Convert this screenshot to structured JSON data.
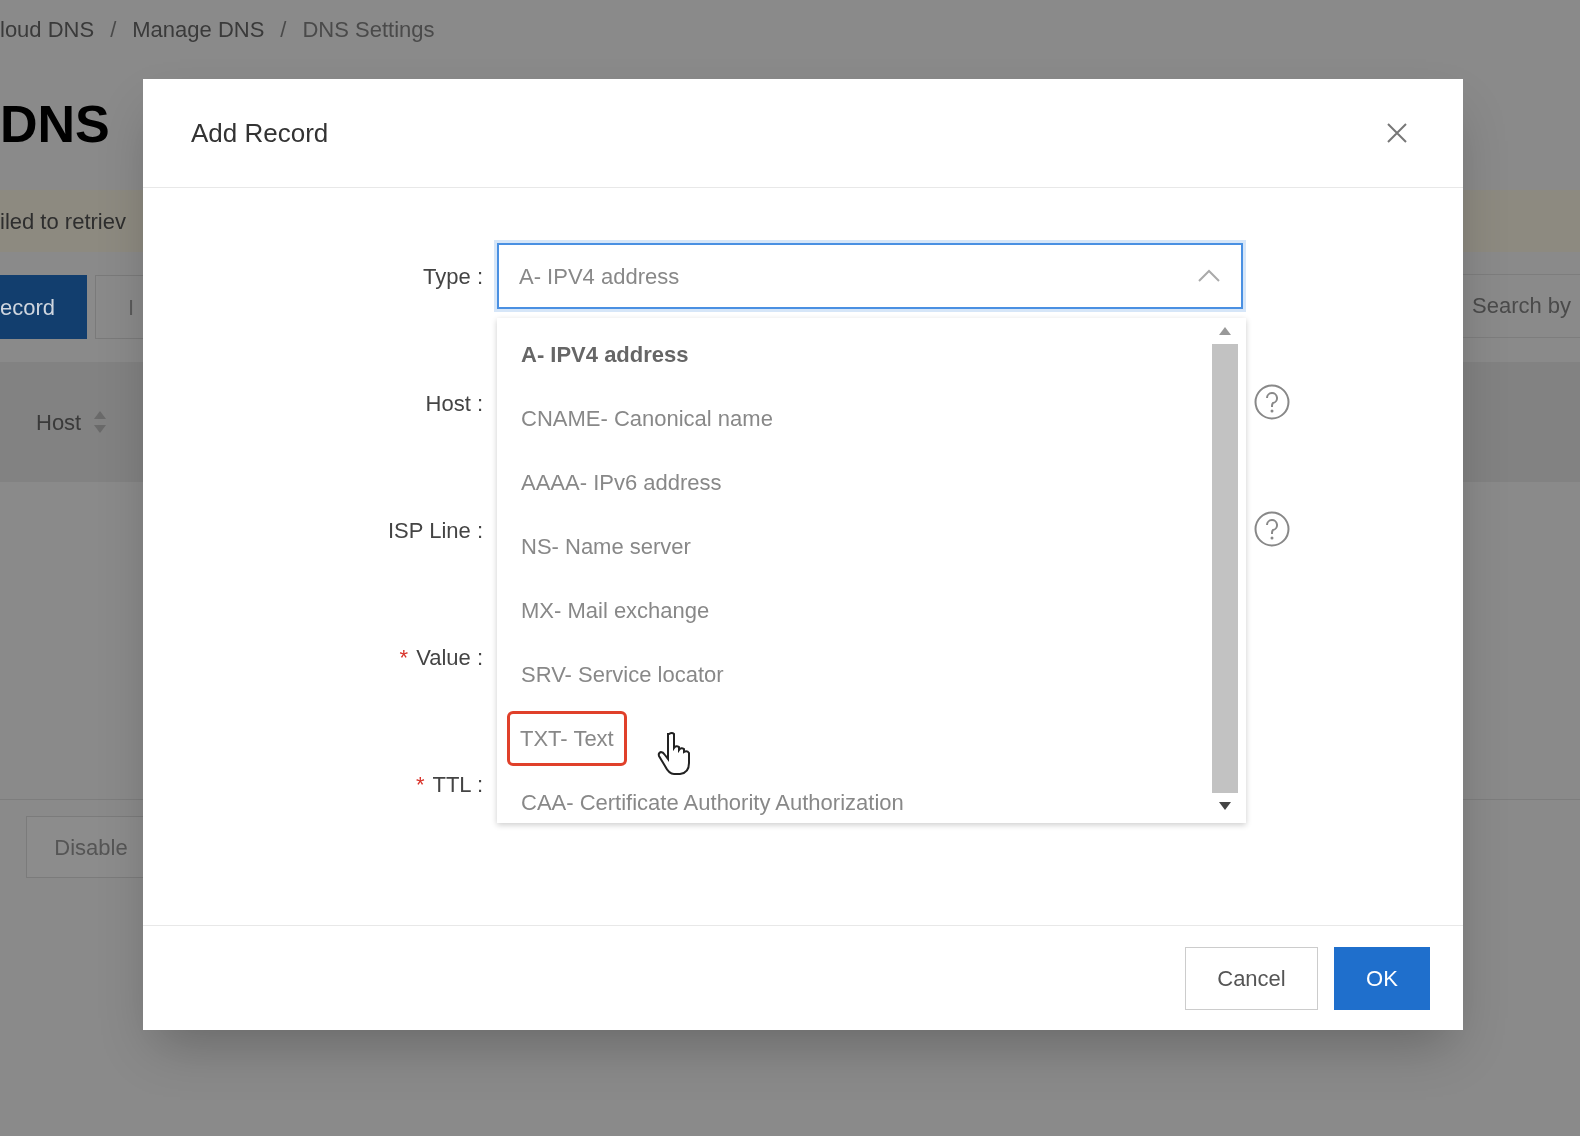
{
  "background": {
    "breadcrumb": [
      "loud DNS",
      "Manage DNS",
      "DNS Settings"
    ],
    "breadcrumb_separator": "/",
    "title": "DNS",
    "alert": "iled to retriev",
    "buttons": [
      {
        "label": "ecord",
        "kind": "primary"
      },
      {
        "label": "I",
        "kind": "default"
      }
    ],
    "search": {
      "placeholder": "Search by"
    },
    "table": {
      "columns": [
        {
          "label": "Host",
          "sortable": true
        }
      ]
    },
    "footer_button": {
      "label": "Disable",
      "disabled": true
    }
  },
  "dialog": {
    "title": "Add Record",
    "fields": [
      {
        "label": "Type :"
      },
      {
        "label": "Host :",
        "help": true
      },
      {
        "label": "ISP Line :",
        "help": true
      },
      {
        "label": "Value :",
        "required_mark": "*"
      },
      {
        "label": "TTL :",
        "required_mark": "*"
      }
    ],
    "type_select": {
      "value": "A- IPV4 address",
      "expanded": true
    },
    "options": [
      {
        "label": "A- IPV4 address",
        "selected": true,
        "highlighted": false
      },
      {
        "label": "CNAME- Canonical name",
        "selected": false,
        "highlighted": false
      },
      {
        "label": "AAAA- IPv6 address",
        "selected": false,
        "highlighted": false
      },
      {
        "label": "NS- Name server",
        "selected": false,
        "highlighted": false
      },
      {
        "label": "MX- Mail exchange",
        "selected": false,
        "highlighted": false
      },
      {
        "label": "SRV- Service locator",
        "selected": false,
        "highlighted": false
      },
      {
        "label": "TXT- Text",
        "selected": false,
        "highlighted": true
      },
      {
        "label": "CAA- Certificate Authority Authorization",
        "selected": false,
        "highlighted": false
      }
    ],
    "buttons": [
      {
        "label": "Cancel",
        "kind": "default"
      },
      {
        "label": "OK",
        "kind": "primary"
      }
    ]
  }
}
